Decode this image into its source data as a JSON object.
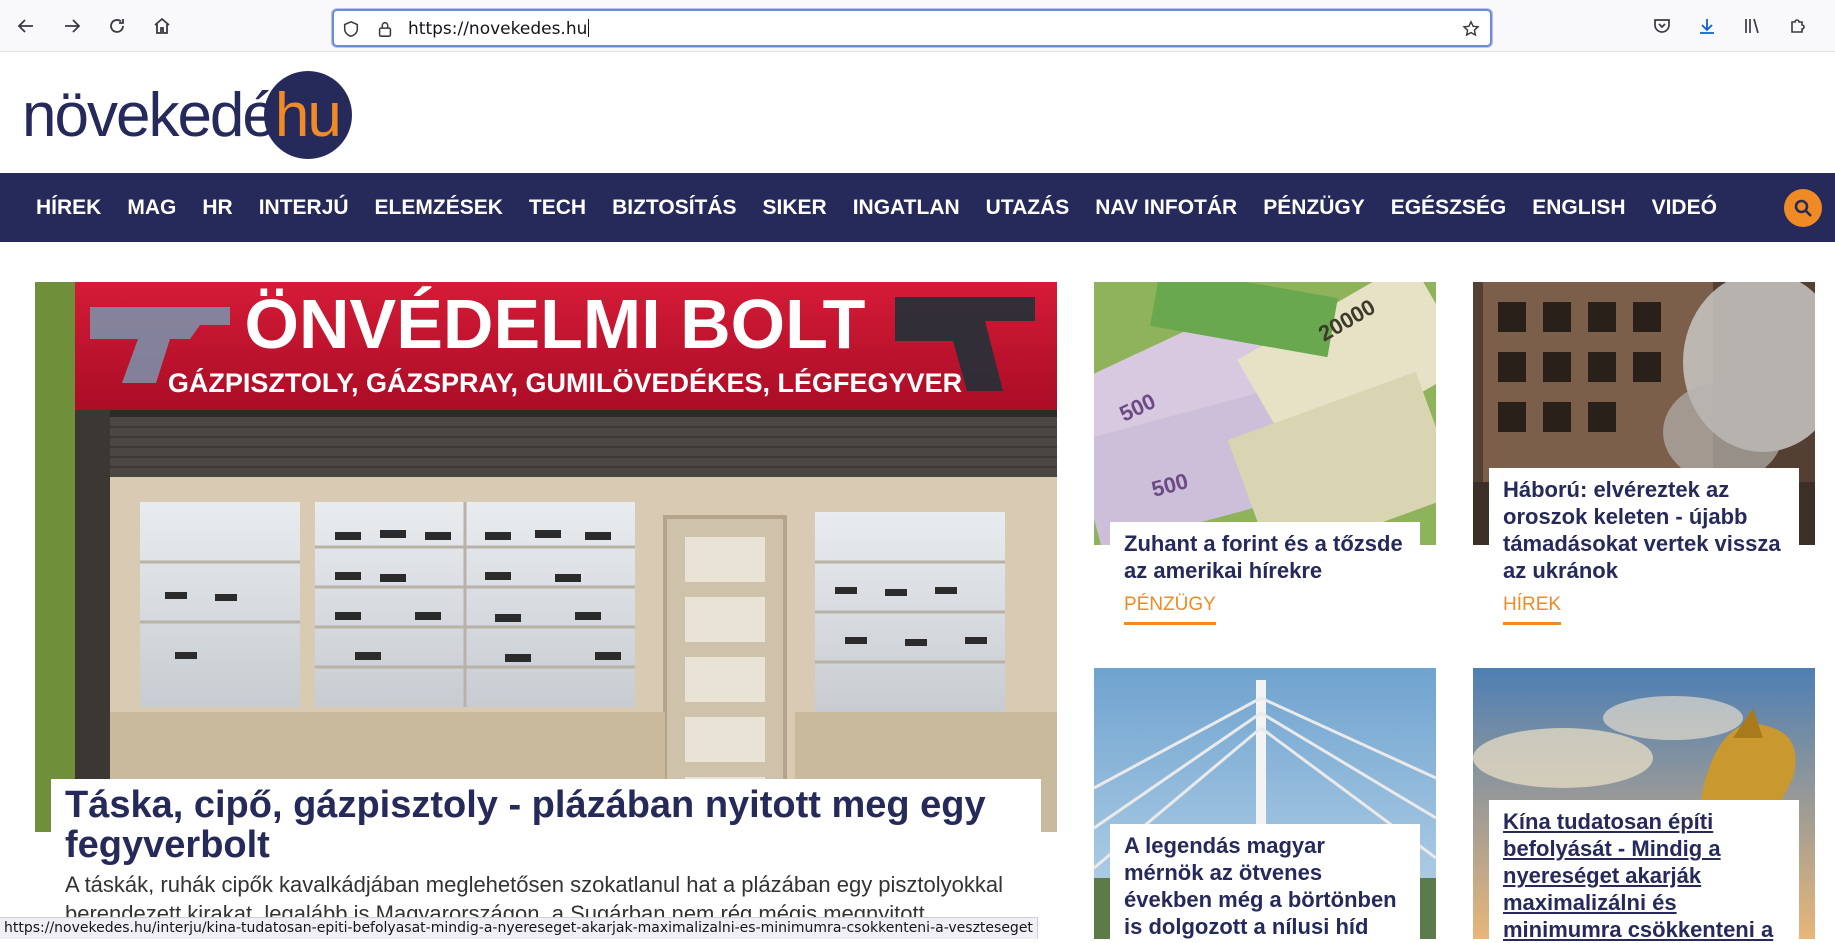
{
  "browser": {
    "url": "https://novekedes.hu",
    "status_url": "https://novekedes.hu/interju/kina-tudatosan-epiti-befolyasat-mindig-a-nyereseget-akarjak-maximalizalni-es-minimumra-csokkenteni-a-veszteseget"
  },
  "site": {
    "logo_main": "növekedés",
    "logo_hu": "hu",
    "brand_color": "#262a5b",
    "accent_color": "#f08a24"
  },
  "nav": {
    "items": [
      "HÍREK",
      "MAG",
      "HR",
      "INTERJÚ",
      "ELEMZÉSEK",
      "TECH",
      "BIZTOSÍTÁS",
      "SIKER",
      "INGATLAN",
      "UTAZÁS",
      "NAV INFOTÁR",
      "PÉNZÜGY",
      "EGÉSZSÉG",
      "ENGLISH",
      "VIDEÓ"
    ]
  },
  "hero": {
    "sign_main": "ÖNVÉDELMI BOLT",
    "sign_sub": "GÁZPISZTOLY, GÁZSPRAY, GUMILÖVEDÉKES, LÉGFEGYVER",
    "title": "Táska, cipő, gázpisztoly - plázában nyitott meg egy fegyverbolt",
    "lead": "A táskák, ruhák cipők kavalkádjában meglehetősen szokatlanul hat a plázában egy pisztolyokkal berendezett kirakat, legalább is Magyarországon, a Sugárban nem rég mégis megnyitott"
  },
  "cards": [
    {
      "title": "Zuhant a forint és a tőzsde az amerikai hírekre",
      "category": "PÉNZÜGY"
    },
    {
      "title": "Háború: elvéreztek az oroszok keleten - újabb támadásokat vertek vissza az ukránok",
      "category": "HÍREK"
    },
    {
      "title": "A legendás magyar mérnök az ötvenes években még a börtönben is dolgozott a nílusi híd"
    },
    {
      "title": "Kína tudatosan építi befolyását - Mindig a nyereséget akarják maximalizálni és minimumra csökkenteni a"
    }
  ]
}
